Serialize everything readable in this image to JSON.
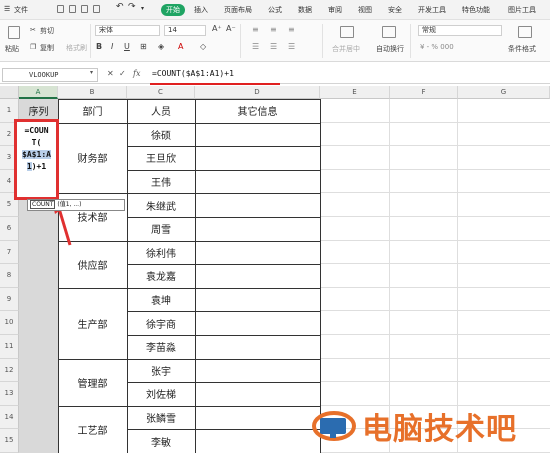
{
  "menu": {
    "file": "文件",
    "start": "开始",
    "tabs": [
      "插入",
      "页面布局",
      "公式",
      "数据",
      "审阅",
      "视图",
      "安全",
      "开发工具",
      "特色功能",
      "图片工具"
    ]
  },
  "ribbon": {
    "paste": "粘贴",
    "cut": "剪切",
    "copy": "复制",
    "format_painter": "格式刷",
    "font_name": "宋体",
    "font_size": "14",
    "merge_center": "合并居中",
    "auto_wrap": "自动换行",
    "number_format": "常规",
    "cond_format": "条件格式"
  },
  "formula_bar": {
    "name_box": "VLOOKUP",
    "cancel": "✕",
    "confirm": "✓",
    "fx": "fx",
    "formula": "=COUNT($A$1:A1)+1"
  },
  "columns": [
    "A",
    "B",
    "C",
    "D",
    "E",
    "F",
    "G"
  ],
  "rows": [
    "1",
    "2",
    "3",
    "4",
    "5",
    "6",
    "7",
    "8",
    "9",
    "10",
    "11",
    "12",
    "13",
    "14",
    "15"
  ],
  "headers": {
    "seq": "序列",
    "dept": "部门",
    "person": "人员",
    "other": "其它信息"
  },
  "departments": [
    "财务部",
    "技术部",
    "供应部",
    "生产部",
    "管理部",
    "工艺部"
  ],
  "people": [
    "徐硕",
    "王旦欣",
    "王伟",
    "朱继武",
    "周雪",
    "徐利伟",
    "袁龙嘉",
    "袁坤",
    "徐宇商",
    "李苗淼",
    "张宇",
    "刘佐梯",
    "张鳞雪",
    "李敏"
  ],
  "editing_cell": {
    "line1": "=COUN",
    "line2": "T(",
    "line3": "$A$1:A",
    "line4_sel": "1",
    "line4_rest": ")+1"
  },
  "tooltip": {
    "fn": "COUNT",
    "args": "(值1, ...)"
  },
  "watermark": "电脑技术吧",
  "colors": {
    "accent": "#1fa463",
    "highlight_red": "#e03030",
    "watermark_orange": "#e7702a"
  }
}
